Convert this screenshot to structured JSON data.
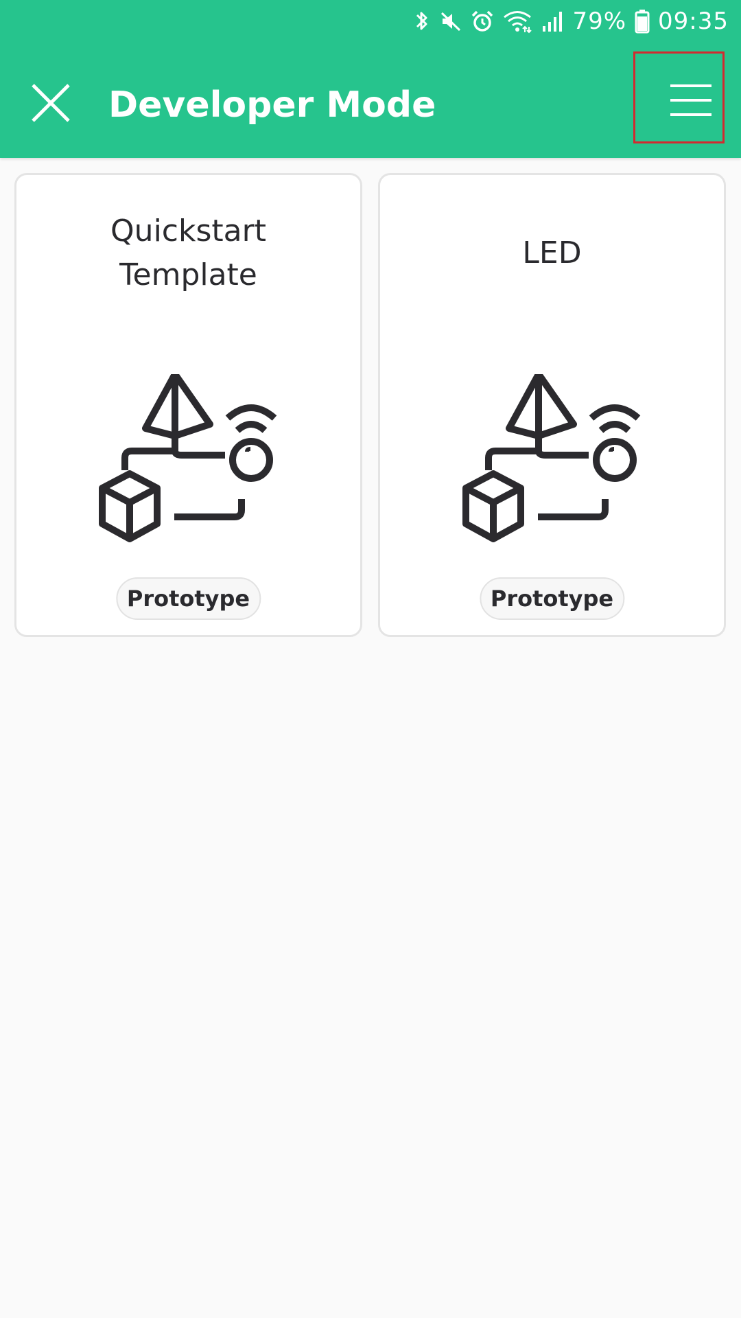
{
  "status_bar": {
    "battery": "79%",
    "time": "09:35",
    "icons": [
      "bluetooth-icon",
      "mute-icon",
      "alarm-icon",
      "wifi-icon",
      "signal-icon",
      "battery-icon"
    ]
  },
  "header": {
    "title": "Developer Mode",
    "close_icon": "close-icon",
    "menu_icon": "hamburger-menu-icon",
    "background_color": "#26c48d",
    "highlight_color": "#d22a2f"
  },
  "templates": [
    {
      "title": "Quickstart Template",
      "badge": "Prototype",
      "icon": "prototype-illustration-icon"
    },
    {
      "title": "LED",
      "badge": "Prototype",
      "icon": "prototype-illustration-icon"
    }
  ]
}
